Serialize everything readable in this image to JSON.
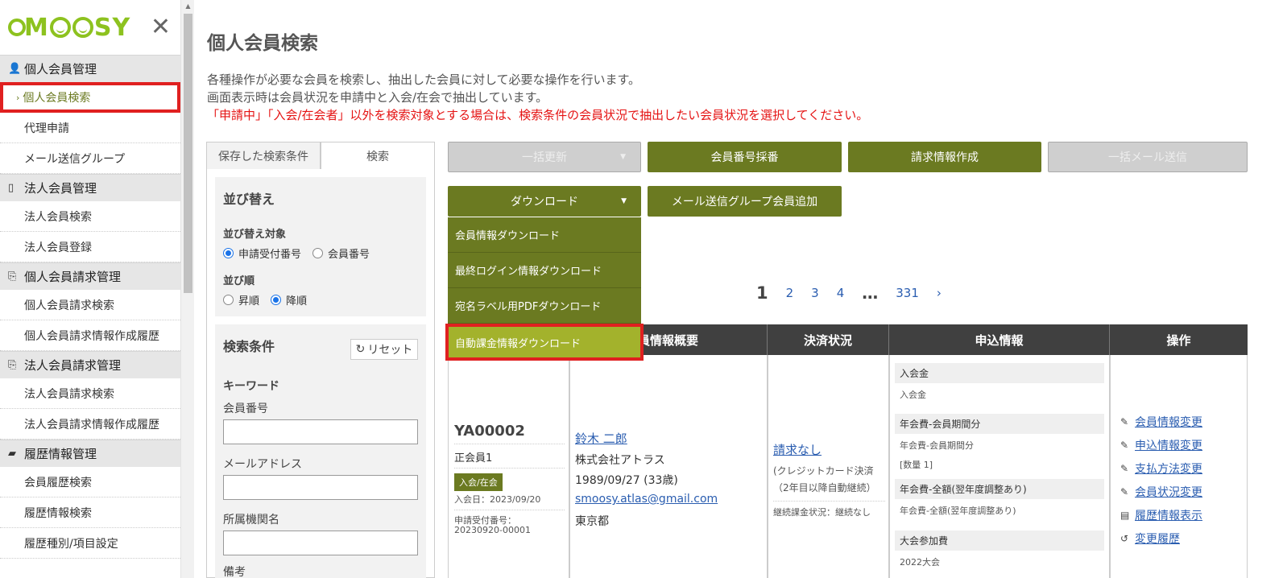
{
  "logo": {
    "text": "SMOOSY",
    "accent": "#8dc21f"
  },
  "colors": {
    "primary_button": "#6b7a21",
    "highlight": "#e02020",
    "warning_text": "#e51414",
    "link": "#2a5db0"
  },
  "sidebar": {
    "sections": [
      {
        "title": "個人会員管理",
        "icon": "user-icon",
        "items": [
          "個人会員検索",
          "代理申請",
          "メール送信グループ"
        ]
      },
      {
        "title": "法人会員管理",
        "icon": "building-icon",
        "items": [
          "法人会員検索",
          "法人会員登録"
        ]
      },
      {
        "title": "個人会員請求管理",
        "icon": "copy-icon",
        "items": [
          "個人会員請求検索",
          "個人会員請求情報作成履歴"
        ]
      },
      {
        "title": "法人会員請求管理",
        "icon": "copy-icon",
        "items": [
          "法人会員請求検索",
          "法人会員請求情報作成履歴"
        ]
      },
      {
        "title": "履歴情報管理",
        "icon": "folder-icon",
        "items": [
          "会員履歴検索",
          "履歴情報検索",
          "履歴種別/項目設定"
        ]
      }
    ],
    "active_item": "個人会員検索"
  },
  "page": {
    "title": "個人会員検索",
    "desc1": "各種操作が必要な会員を検索し、抽出した会員に対して必要な操作を行います。",
    "desc2": "画面表示時は会員状況を申請中と入会/在会で抽出しています。",
    "warning": "「申請中」「入会/在会者」以外を検索対象とする場合は、検索条件の会員状況で抽出したい会員状況を選択してください。"
  },
  "search_panel": {
    "tabs": [
      "保存した検索条件",
      "検索"
    ],
    "sort_title": "並び替え",
    "sort_target_label": "並び替え対象",
    "sort_target_options": [
      "申請受付番号",
      "会員番号"
    ],
    "sort_order_label": "並び順",
    "sort_order_options": [
      "昇順",
      "降順"
    ],
    "criteria_title": "検索条件",
    "reset_label": "リセット",
    "keyword_label": "キーワード",
    "member_no_label": "会員番号",
    "email_label": "メールアドレス",
    "org_label": "所属機関名",
    "note_label": "備考"
  },
  "actions": {
    "bulk_update": "一括更新",
    "member_no_assign": "会員番号採番",
    "billing_create": "請求情報作成",
    "bulk_mail": "一括メール送信",
    "download": "ダウンロード",
    "mail_group_add": "メール送信グループ会員追加"
  },
  "download_menu": [
    "会員情報ダウンロード",
    "最終ログイン情報ダウンロード",
    "宛名ラベル用PDFダウンロード",
    "自動課金情報ダウンロード"
  ],
  "pager": {
    "current": "1",
    "pages": [
      "2",
      "3",
      "4"
    ],
    "dots": "…",
    "last": "331",
    "next": "›"
  },
  "table": {
    "headers": [
      "員情報概要",
      "決済状況",
      "申込情報",
      "操作"
    ],
    "row": {
      "member_id": "YA00002",
      "member_type": "正会員1",
      "status_badge": "入会/在会",
      "join_date": "入会日：2023/09/20",
      "app_no_label": "申請受付番号：",
      "app_no": "20230920-00001",
      "name": "鈴木 二郎",
      "company": "株式会社アトラス",
      "birth": "1989/09/27 (33歳)",
      "email": "smoosy.atlas@gmail.com",
      "pref": "東京都",
      "payment_link": "請求なし",
      "payment_note1": "(クレジットカード決済",
      "payment_note2": "（2年目以降自動継続）",
      "payment_status": "継続課金状況：継続なし",
      "app_sections": [
        {
          "head": "入会金",
          "lines": [
            "入会金"
          ]
        },
        {
          "head": "年会費-会員期間分",
          "lines": [
            "年会費-会員期間分",
            "[数量 1]"
          ]
        },
        {
          "head": "年会費-全額(翌年度調整あり)",
          "lines": [
            "年会費-全額(翌年度調整あり)"
          ]
        },
        {
          "head": "大会参加費",
          "lines": [
            "2022大会"
          ]
        }
      ],
      "ops": [
        "会員情報変更",
        "申込情報変更",
        "支払方法変更",
        "会員状況変更",
        "履歴情報表示",
        "変更履歴"
      ]
    }
  }
}
